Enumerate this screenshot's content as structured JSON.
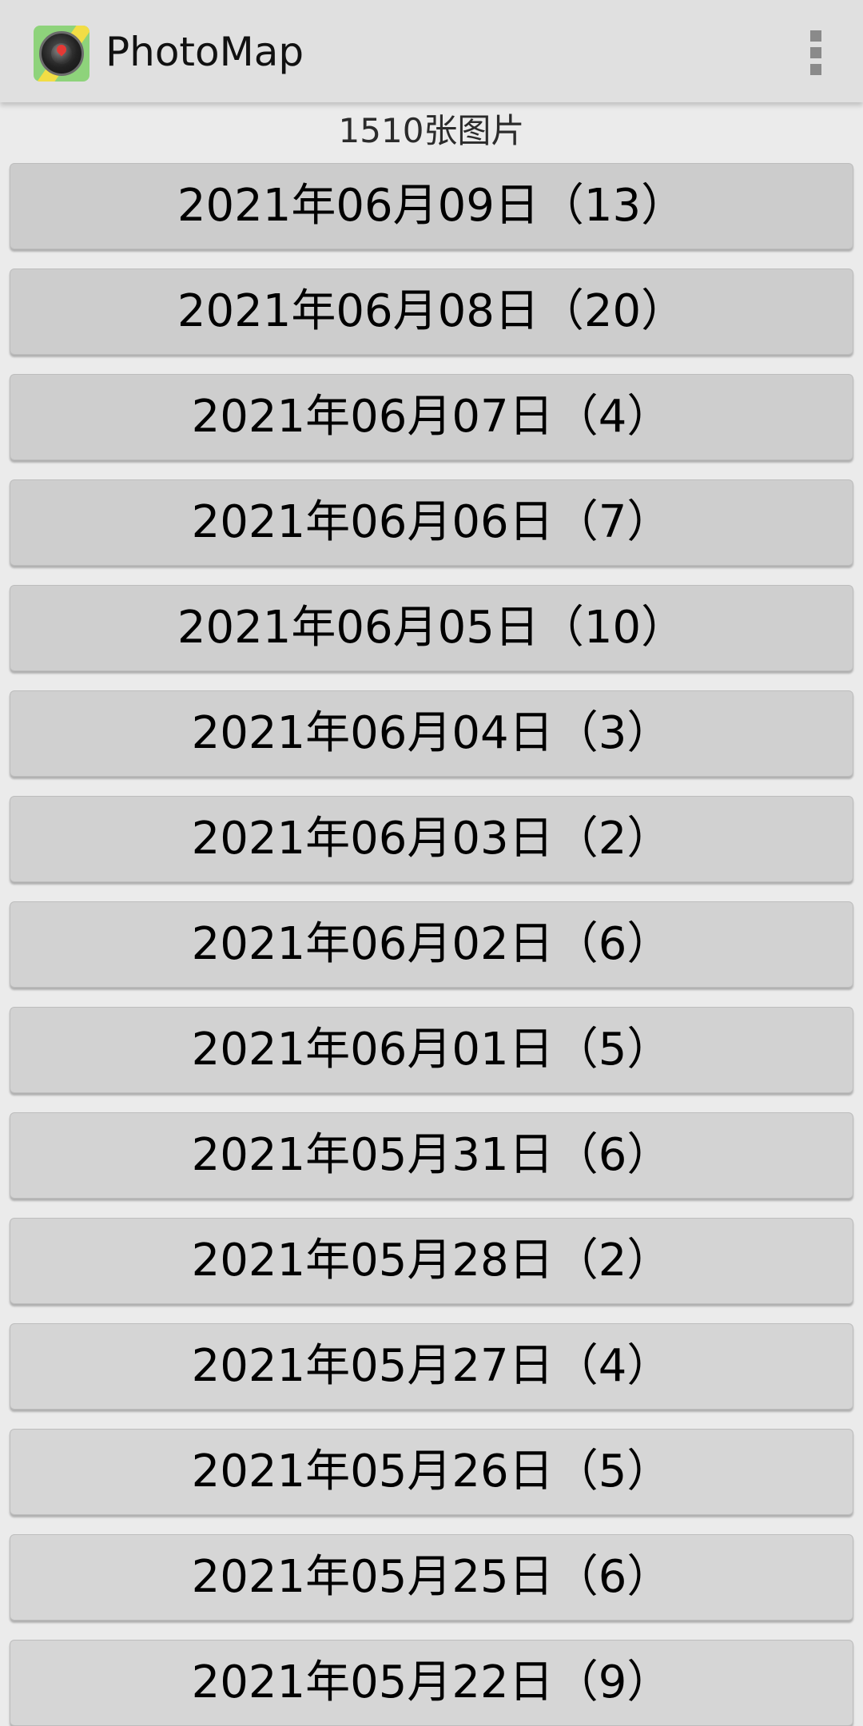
{
  "app": {
    "title": "PhotoMap",
    "icon": "photomap-app-icon",
    "menu_icon": "more-vert-icon"
  },
  "summary": {
    "count_label": "1510张图片"
  },
  "colors": {
    "appbar_bg": "#e0e0e0",
    "page_bg": "#ebebeb",
    "button_bg": "#d6d6d6"
  },
  "dates": [
    {
      "label": "2021年06月09日（13）"
    },
    {
      "label": "2021年06月08日（20）"
    },
    {
      "label": "2021年06月07日（4）"
    },
    {
      "label": "2021年06月06日（7）"
    },
    {
      "label": "2021年06月05日（10）"
    },
    {
      "label": "2021年06月04日（3）"
    },
    {
      "label": "2021年06月03日（2）"
    },
    {
      "label": "2021年06月02日（6）"
    },
    {
      "label": "2021年06月01日（5）"
    },
    {
      "label": "2021年05月31日（6）"
    },
    {
      "label": "2021年05月28日（2）"
    },
    {
      "label": "2021年05月27日（4）"
    },
    {
      "label": "2021年05月26日（5）"
    },
    {
      "label": "2021年05月25日（6）"
    },
    {
      "label": "2021年05月22日（9）"
    }
  ]
}
